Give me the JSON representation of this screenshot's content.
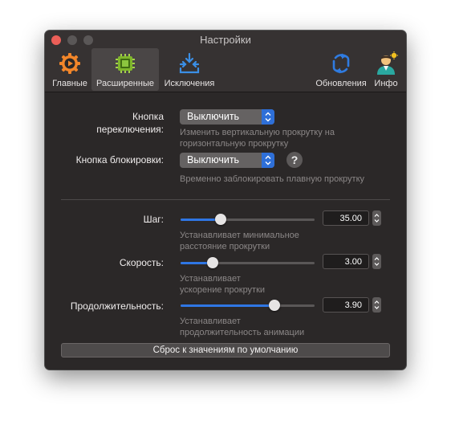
{
  "window": {
    "title": "Настройки"
  },
  "toolbar": {
    "tabs": [
      {
        "label": "Главные",
        "icon": "gear-play-icon"
      },
      {
        "label": "Расширенные",
        "icon": "chip-icon",
        "active": true
      },
      {
        "label": "Исключения",
        "icon": "exclusions-icon"
      },
      {
        "label": "Обновления",
        "icon": "refresh-icon"
      },
      {
        "label": "Инфо",
        "icon": "person-icon"
      }
    ]
  },
  "toggle_button": {
    "label": "Кнопка переключения:",
    "label_line1": "Кнопка",
    "label_line2": "переключения:",
    "value": "Выключить",
    "hint_line1": "Изменить вертикальную прокрутку на",
    "hint_line2": "горизонтальную прокрутку"
  },
  "lock_button": {
    "label": "Кнопка блокировки:",
    "value": "Выключить",
    "help": "?",
    "hint": "Временно заблокировать плавную прокрутку"
  },
  "step": {
    "label": "Шаг:",
    "value": "35.00",
    "slider_fraction": 0.3,
    "hint_line1": "Устанавливает минимальное",
    "hint_line2": "расстояние прокрутки"
  },
  "speed": {
    "label": "Скорость:",
    "value": "3.00",
    "slider_fraction": 0.24,
    "hint_line1": "Устанавливает",
    "hint_line2": "ускорение прокрутки"
  },
  "duration": {
    "label": "Продолжительность:",
    "value": "3.90",
    "slider_fraction": 0.7,
    "hint_line1": "Устанавливает",
    "hint_line2": "продолжительность анимации"
  },
  "reset_button": {
    "label": "Сброс к значениям по умолчанию"
  },
  "colors": {
    "accent": "#2f76e4",
    "close": "#ec5f58",
    "window_bg": "#2b2828"
  }
}
